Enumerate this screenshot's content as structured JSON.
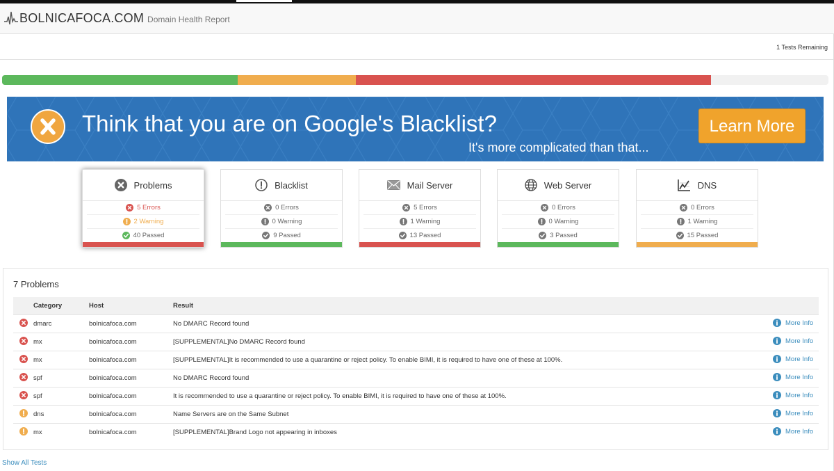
{
  "header": {
    "brand": "BOLNICAFOCA.COM",
    "subtitle": "Domain Health Report",
    "tests_remaining": "1 Tests Remaining"
  },
  "progress": {
    "segments": [
      {
        "fraction": 0.285,
        "color": "#5cb85c"
      },
      {
        "fraction": 0.143,
        "color": "#f0ad4e"
      },
      {
        "fraction": 0.43,
        "color": "#d9534f"
      }
    ]
  },
  "banner": {
    "title": "Think that you are on Google's Blacklist?",
    "subtitle": "It's more complicated than that...",
    "button": "Learn More"
  },
  "cards": [
    {
      "title": "Problems",
      "icon": "x-circle-icon",
      "errors": "5 Errors",
      "warnings": "2 Warning",
      "passed": "40 Passed",
      "status": "error",
      "active": true
    },
    {
      "title": "Blacklist",
      "icon": "exclamation-circle-icon",
      "errors": "0 Errors",
      "warnings": "0 Warning",
      "passed": "9 Passed",
      "status": "ok",
      "active": false
    },
    {
      "title": "Mail Server",
      "icon": "envelope-icon",
      "errors": "5 Errors",
      "warnings": "1 Warning",
      "passed": "13 Passed",
      "status": "error",
      "active": false
    },
    {
      "title": "Web Server",
      "icon": "globe-icon",
      "errors": "0 Errors",
      "warnings": "0 Warning",
      "passed": "3 Passed",
      "status": "ok",
      "active": false
    },
    {
      "title": "DNS",
      "icon": "chart-icon",
      "errors": "0 Errors",
      "warnings": "1 Warning",
      "passed": "15 Passed",
      "status": "warning",
      "active": false
    }
  ],
  "colors": {
    "error": "#d9534f",
    "warning": "#f0ad4e",
    "ok": "#5cb85c",
    "link": "#3b8dbd"
  },
  "problems": {
    "title": "7 Problems",
    "columns": [
      "Category",
      "Host",
      "Result"
    ],
    "more_info": "More Info",
    "rows": [
      {
        "status": "error",
        "category": "dmarc",
        "host": "bolnicafoca.com",
        "result": "No DMARC Record found"
      },
      {
        "status": "error",
        "category": "mx",
        "host": "bolnicafoca.com",
        "result": "[SUPPLEMENTAL]No DMARC Record found"
      },
      {
        "status": "error",
        "category": "mx",
        "host": "bolnicafoca.com",
        "result": "[SUPPLEMENTAL]It is recommended to use a quarantine or reject policy. To enable BIMI, it is required to have one of these at 100%."
      },
      {
        "status": "error",
        "category": "spf",
        "host": "bolnicafoca.com",
        "result": "No DMARC Record found"
      },
      {
        "status": "error",
        "category": "spf",
        "host": "bolnicafoca.com",
        "result": "It is recommended to use a quarantine or reject policy. To enable BIMI, it is required to have one of these at 100%."
      },
      {
        "status": "warning",
        "category": "dns",
        "host": "bolnicafoca.com",
        "result": "Name Servers are on the Same Subnet"
      },
      {
        "status": "warning",
        "category": "mx",
        "host": "bolnicafoca.com",
        "result": "[SUPPLEMENTAL]Brand Logo not appearing in inboxes"
      }
    ]
  },
  "footer": {
    "show_all": "Show All Tests"
  }
}
